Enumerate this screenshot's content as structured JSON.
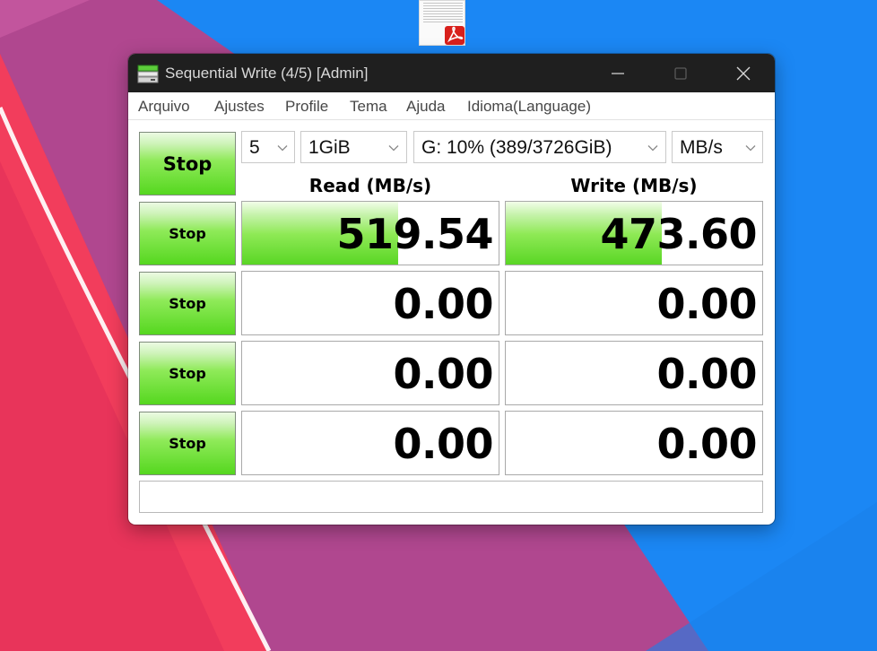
{
  "window": {
    "title": "Sequential Write (4/5) [Admin]"
  },
  "menu": [
    "Arquivo",
    "Ajustes",
    "Profile",
    "Tema",
    "Ajuda",
    "Idioma(Language)"
  ],
  "controls": {
    "all_button_label": "Stop",
    "test_count": "5",
    "test_size": "1GiB",
    "drive": "G: 10% (389/3726GiB)",
    "unit": "MB/s"
  },
  "columns": {
    "read_header": "Read (MB/s)",
    "write_header": "Write (MB/s)"
  },
  "rows": [
    {
      "button_label": "Stop",
      "read": "519.54",
      "write": "473.60",
      "read_level": 0.61,
      "write_level": 0.61
    },
    {
      "button_label": "Stop",
      "read": "0.00",
      "write": "0.00",
      "read_level": 0,
      "write_level": 0
    },
    {
      "button_label": "Stop",
      "read": "0.00",
      "write": "0.00",
      "read_level": 0,
      "write_level": 0
    },
    {
      "button_label": "Stop",
      "read": "0.00",
      "write": "0.00",
      "read_level": 0,
      "write_level": 0
    }
  ],
  "status_text": "",
  "icons": {
    "app": "disk-drive-icon",
    "file": "pdf-file-icon"
  },
  "colors": {
    "accent_green": "#55d71f",
    "titlebar": "#1f1f1f"
  }
}
